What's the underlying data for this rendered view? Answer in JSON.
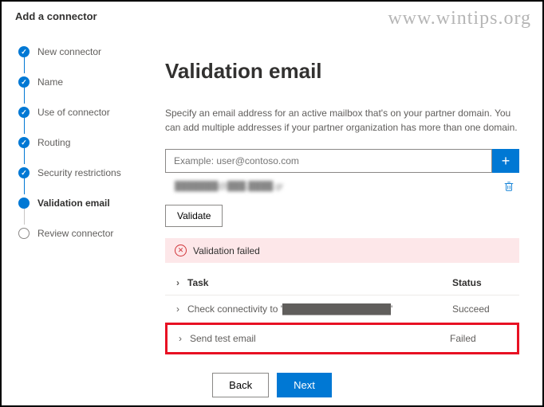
{
  "watermark": "www.wintips.org",
  "header": {
    "title": "Add a connector"
  },
  "stepper": {
    "items": [
      {
        "label": "New connector",
        "state": "done"
      },
      {
        "label": "Name",
        "state": "done"
      },
      {
        "label": "Use of connector",
        "state": "done"
      },
      {
        "label": "Routing",
        "state": "done"
      },
      {
        "label": "Security restrictions",
        "state": "done"
      },
      {
        "label": "Validation email",
        "state": "active"
      },
      {
        "label": "Review connector",
        "state": "pending"
      }
    ]
  },
  "main": {
    "title": "Validation email",
    "description": "Specify an email address for an active mailbox that's on your partner domain. You can add multiple addresses if your partner organization has more than one domain.",
    "input_placeholder": "Example: user@contoso.com",
    "added_email": "███████@███.████.gr",
    "validate_label": "Validate",
    "alert_text": "Validation failed",
    "table": {
      "header_task": "Task",
      "header_status": "Status",
      "rows": [
        {
          "task": "Check connectivity to '████████████████'",
          "status": "Succeed"
        },
        {
          "task": "Send test email",
          "status": "Failed"
        }
      ]
    }
  },
  "footer": {
    "back": "Back",
    "next": "Next"
  }
}
